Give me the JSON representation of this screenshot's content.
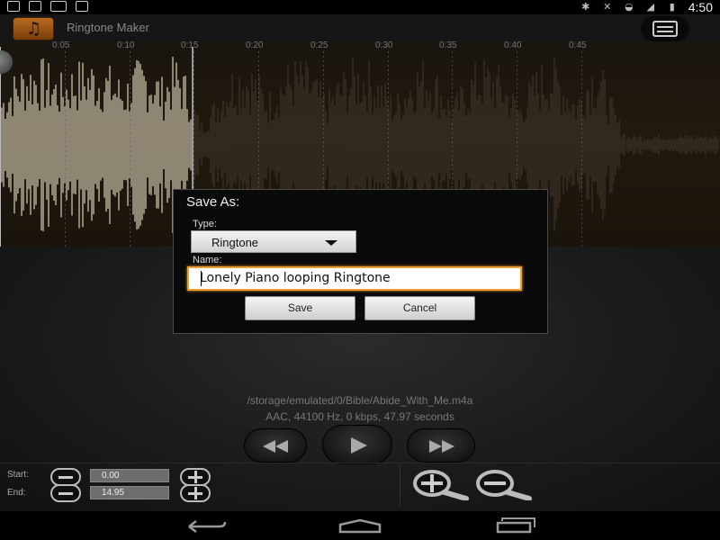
{
  "status_bar": {
    "time": "4:50"
  },
  "app_bar": {
    "title": "Ringtone Maker"
  },
  "timeline": {
    "ticks": [
      "0:05",
      "0:10",
      "0:15",
      "0:20",
      "0:25",
      "0:30",
      "0:35",
      "0:40",
      "0:45"
    ]
  },
  "file": {
    "path": "/storage/emulated/0/Bible/Abide_With_Me.m4a",
    "info": "AAC, 44100 Hz, 0 kbps, 47.97 seconds"
  },
  "controls": {
    "start_label": "Start:",
    "end_label": "End:",
    "start_value": "0.00",
    "end_value": "14.95"
  },
  "dialog": {
    "title": "Save As:",
    "type_label": "Type:",
    "type_value": "Ringtone",
    "name_label": "Name:",
    "name_value": "Lonely Piano looping Ringtone",
    "save_label": "Save",
    "cancel_label": "Cancel"
  },
  "colors": {
    "accent": "#f0a030",
    "app_icon": "#b86a1e"
  }
}
